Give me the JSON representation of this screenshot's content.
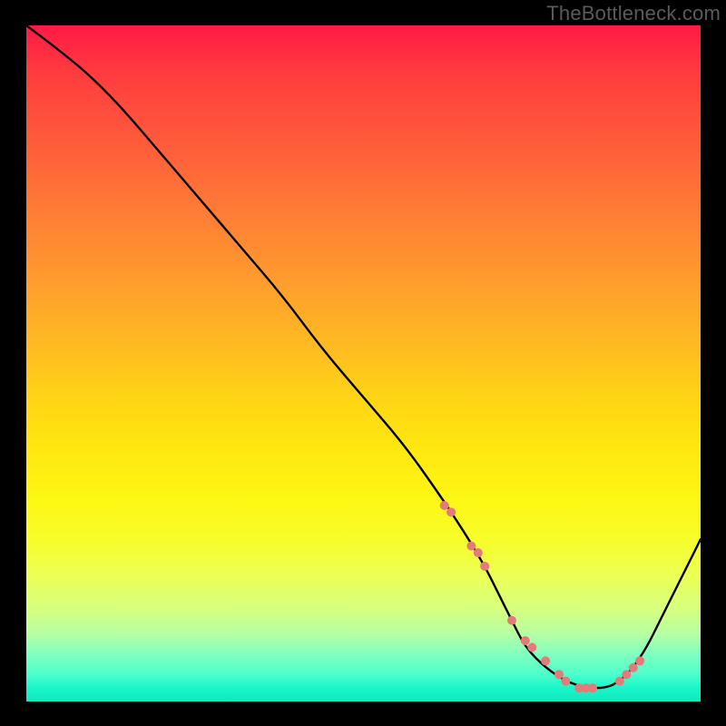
{
  "watermark": "TheBottleneck.com",
  "chart_data": {
    "type": "line",
    "title": "",
    "xlabel": "",
    "ylabel": "",
    "xlim": [
      0,
      100
    ],
    "ylim": [
      0,
      100
    ],
    "curve": {
      "x": [
        0,
        4,
        9,
        14,
        20,
        26,
        32,
        38,
        44,
        50,
        56,
        61,
        65,
        68,
        70,
        72,
        74,
        77,
        80,
        83,
        86,
        88,
        90,
        92,
        94,
        96,
        98,
        100
      ],
      "y": [
        100,
        97,
        93,
        88,
        81,
        74,
        67,
        60,
        52,
        45,
        38,
        31,
        25,
        20,
        16,
        12,
        8,
        5,
        3,
        2,
        2,
        3,
        5,
        8,
        12,
        16,
        20,
        24
      ]
    },
    "markers": {
      "x": [
        62,
        63,
        66,
        67,
        68,
        72,
        74,
        75,
        77,
        79,
        80,
        82,
        83,
        84,
        88,
        89,
        90,
        91
      ],
      "y": [
        29,
        28,
        23,
        22,
        20,
        12,
        9,
        8,
        6,
        4,
        3,
        2,
        2,
        2,
        3,
        4,
        5,
        6
      ]
    },
    "gradient_stops": [
      {
        "pos": 0,
        "color": "#ff1a46"
      },
      {
        "pos": 50,
        "color": "#ffd416"
      },
      {
        "pos": 100,
        "color": "#10e8bd"
      }
    ]
  }
}
